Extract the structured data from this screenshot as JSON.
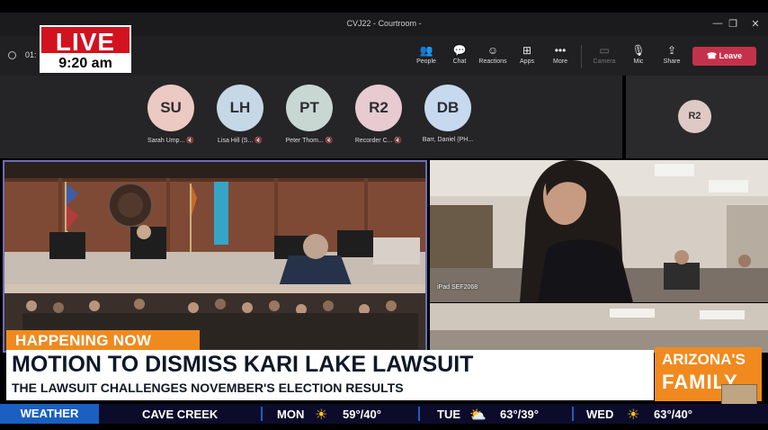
{
  "window": {
    "title": "CVJ22 - Courtroom -"
  },
  "meeting": {
    "timer": "01:",
    "toolbar": [
      {
        "icon": "people-icon",
        "label": "People"
      },
      {
        "icon": "chat-icon",
        "label": "Chat"
      },
      {
        "icon": "reactions-icon",
        "label": "Reactions"
      },
      {
        "icon": "apps-icon",
        "label": "Apps"
      },
      {
        "icon": "more-icon",
        "label": "More"
      },
      {
        "icon": "camera-off-icon",
        "label": "Camera"
      },
      {
        "icon": "mic-off-icon",
        "label": "Mic"
      },
      {
        "icon": "share-icon",
        "label": "Share"
      }
    ],
    "leave_label": "Leave"
  },
  "participants": [
    {
      "initials": "SU",
      "name": "Sarah Ump...",
      "color": "#ecc9c3"
    },
    {
      "initials": "LH",
      "name": "Lisa Hill (S...",
      "color": "#c6d7e6"
    },
    {
      "initials": "PT",
      "name": "Peter Thom...",
      "color": "#c9d7d2"
    },
    {
      "initials": "R2",
      "name": "Recorder C...",
      "color": "#e7cbd0"
    },
    {
      "initials": "DB",
      "name": "Barr, Daniel (PH...",
      "color": "#c6d9ef"
    }
  ],
  "side_participant": {
    "initials": "R2"
  },
  "video": {
    "ipad_label": "iPad SEF2068"
  },
  "live": {
    "label": "LIVE",
    "time": "9:20 am"
  },
  "lower_third": {
    "tag": "HAPPENING NOW",
    "headline": "MOTION TO DISMISS KARI LAKE LAWSUIT",
    "subline": "THE LAWSUIT CHALLENGES NOVEMBER'S ELECTION RESULTS"
  },
  "logo": {
    "line1": "ARIZONA'S",
    "line2": "FAMILY",
    "bug": "ARIZONA'S FAMILY 5"
  },
  "ticker": {
    "section": "WEATHER",
    "location": "CAVE CREEK",
    "days": [
      {
        "day": "MON",
        "icon": "sun-icon",
        "temps": "59°/40°"
      },
      {
        "day": "TUE",
        "icon": "partly-cloudy-icon",
        "temps": "63°/39°"
      },
      {
        "day": "WED",
        "icon": "sun-icon",
        "temps": "63°/40°"
      }
    ]
  }
}
